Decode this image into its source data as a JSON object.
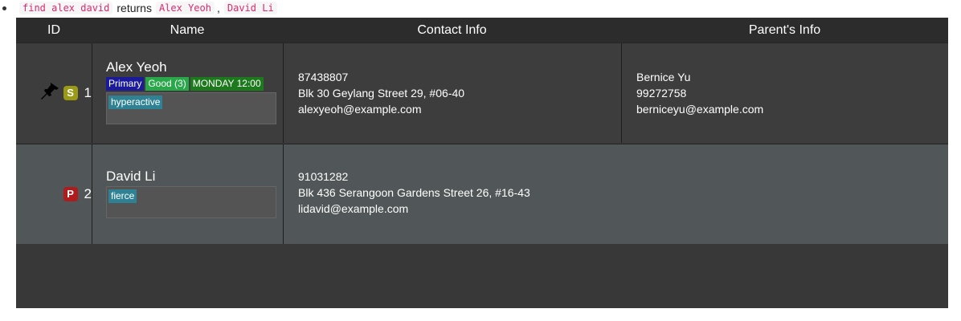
{
  "caption": {
    "command": "find alex david",
    "returns_text": "returns",
    "result1": "Alex Yeoh",
    "separator": ",",
    "result2": "David Li"
  },
  "table": {
    "headers": {
      "id": "ID",
      "name": "Name",
      "contact": "Contact Info",
      "parent": "Parent's Info"
    },
    "rows": [
      {
        "id": "1",
        "level": "S",
        "name": "Alex Yeoh",
        "tags": [
          "Primary",
          "Good (3)",
          "MONDAY 12:00"
        ],
        "note_tags": [
          "hyperactive"
        ],
        "phone": "87438807",
        "address": "Blk 30 Geylang Street 29, #06-40",
        "email": "alexyeoh@example.com",
        "parent_name": "Bernice Yu",
        "parent_phone": "99272758",
        "parent_email": "berniceyu@example.com"
      },
      {
        "id": "2",
        "level": "P",
        "name": "David Li",
        "note_tags": [
          "fierce"
        ],
        "phone": "91031282",
        "address": "Blk 436 Serangoon Gardens Street 26, #16-43",
        "email": "lidavid@example.com"
      }
    ]
  },
  "colors": {
    "level_s": "#9a9a16",
    "level_p": "#b01c1c",
    "tag_primary": "#1a1a9a",
    "tag_good": "#29a84a",
    "tag_day": "#1c7a1c",
    "note_tag": "#2e8294",
    "code_text": "#e0286e"
  },
  "icons": {
    "pin": "pushpin-icon"
  }
}
